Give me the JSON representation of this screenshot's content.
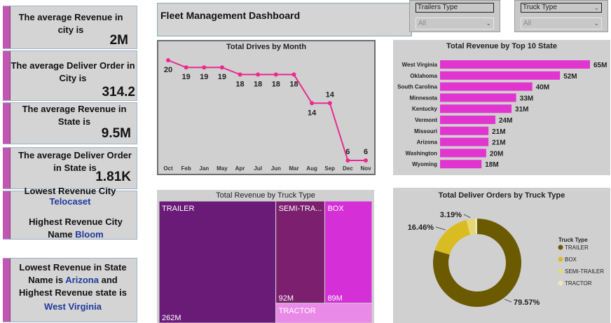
{
  "kpis": {
    "avg_revenue_city_label": "The average Revenue in city is",
    "avg_revenue_city_value": "2M",
    "avg_order_city_label": "The average  Deliver Order in City is",
    "avg_order_city_value": "314.2",
    "avg_revenue_state_label": "The average Revenue in State is",
    "avg_revenue_state_value": "9.5M",
    "avg_order_state_label": "The average  Deliver Order in State is",
    "avg_order_state_value": "1.81K",
    "lowest_city_label": "Lowest Revenue City",
    "lowest_city_value": "Telocaset",
    "highest_city_label": "Highest Revenue City Name",
    "highest_city_value": "Bloom",
    "state_line1": "Lowest Revenue in State",
    "state_line2a": "Name  is",
    "state_lowest": "Arizona",
    "state_line2b": "and",
    "state_line3": "Highest Revenue state is",
    "state_highest": "West Virginia"
  },
  "header": {
    "title": "Fleet Management  Dashboard"
  },
  "slicers": [
    {
      "title": "Trailers Type",
      "value": "All"
    },
    {
      "title": "Truck Type",
      "value": "All"
    }
  ],
  "colors": {
    "magenta": "#e135d0",
    "line_pink": "#ea2a8e",
    "panel": "#d0d0d0",
    "kpi_bar": "#c257b3"
  },
  "chart_data": [
    {
      "type": "line",
      "title": "Total Drives by Month",
      "categories": [
        "Oct",
        "Feb",
        "Jan",
        "May",
        "Apr",
        "Jul",
        "Jun",
        "Mar",
        "Aug",
        "Sep",
        "Dec",
        "Nov"
      ],
      "values": [
        20,
        19,
        19,
        19,
        18,
        18,
        18,
        18,
        14,
        14,
        6,
        6
      ],
      "color": "#ea2a8e"
    },
    {
      "type": "bar",
      "orientation": "horizontal",
      "title": "Total Revenue by Top 10 State",
      "categories": [
        "West Virginia",
        "Oklahoma",
        "South Carolina",
        "Minnesota",
        "Kentucky",
        "Vermont",
        "Missouri",
        "Arizona",
        "Washington",
        "Wyoming"
      ],
      "values": [
        65,
        52,
        40,
        33,
        31,
        24,
        21,
        21,
        20,
        18
      ],
      "labels": [
        "65M",
        "52M",
        "40M",
        "33M",
        "31M",
        "24M",
        "21M",
        "21M",
        "20M",
        "18M"
      ],
      "color": "#e135d0"
    },
    {
      "type": "treemap",
      "title": "Total Revenue by Truck Type",
      "items": [
        {
          "name": "TRAILER",
          "value": 262,
          "label": "262M",
          "color": "#6a1b78"
        },
        {
          "name": "SEMI-TRA...",
          "value": 92,
          "label": "92M",
          "color": "#7c1f6f"
        },
        {
          "name": "BOX",
          "value": 89,
          "label": "89M",
          "color": "#d52fd8"
        },
        {
          "name": "TRACTOR",
          "value": 35,
          "label": "",
          "color": "#ea8ae8"
        }
      ]
    },
    {
      "type": "pie",
      "donut": true,
      "title": "Total Deliver Orders by Truck Type",
      "legend_title": "Truck Type",
      "legend_position": "right",
      "slices": [
        {
          "name": "TRAILER",
          "value": 79.57,
          "label": "79.57%",
          "color": "#6b5a00"
        },
        {
          "name": "BOX",
          "value": 16.46,
          "label": "16.46%",
          "color": "#d8bc22"
        },
        {
          "name": "SEMI-TRAILER",
          "value": 3.19,
          "label": "3.19%",
          "color": "#e6d776"
        },
        {
          "name": "TRACTOR",
          "value": 0.78,
          "label": "",
          "color": "#ede6b8"
        }
      ]
    }
  ]
}
